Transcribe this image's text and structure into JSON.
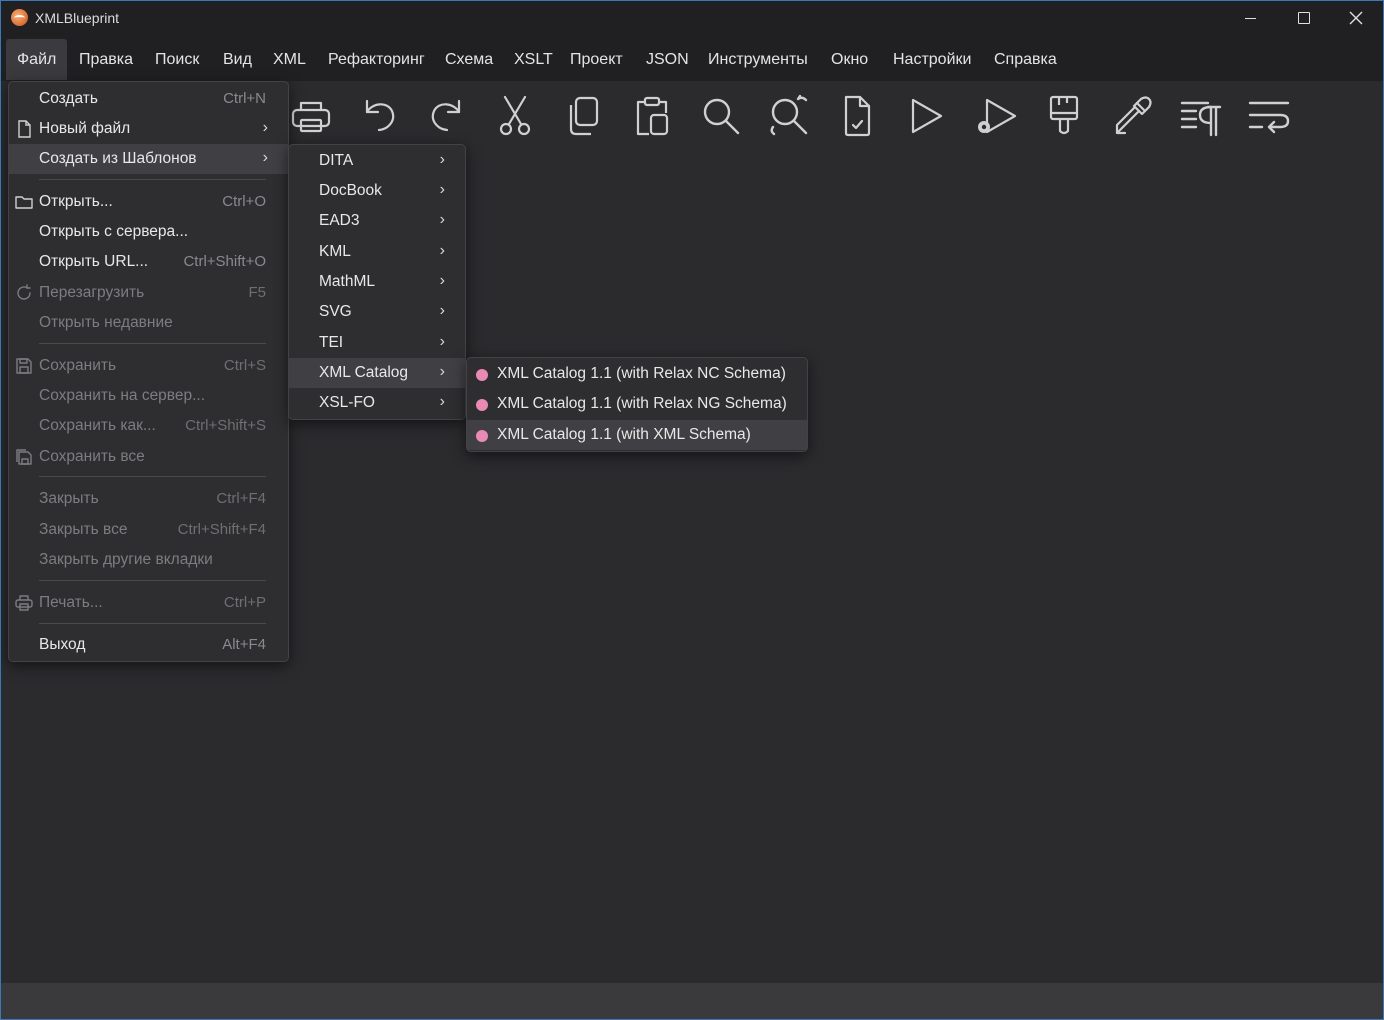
{
  "window": {
    "title": "XMLBlueprint"
  },
  "menubar": [
    {
      "label": "Файл",
      "active": true
    },
    {
      "label": "Правка"
    },
    {
      "label": "Поиск"
    },
    {
      "label": "Вид"
    },
    {
      "label": "XML"
    },
    {
      "label": "Рефакторинг"
    },
    {
      "label": "Схема"
    },
    {
      "label": "XSLT"
    },
    {
      "label": "Проект"
    },
    {
      "label": "JSON"
    },
    {
      "label": "Инструменты"
    },
    {
      "label": "Окно"
    },
    {
      "label": "Настройки"
    },
    {
      "label": "Справка"
    }
  ],
  "toolbar": [
    {
      "icon": "print-icon"
    },
    {
      "icon": "undo-icon"
    },
    {
      "icon": "redo-icon"
    },
    {
      "icon": "cut-icon"
    },
    {
      "icon": "copy-icon"
    },
    {
      "icon": "paste-icon"
    },
    {
      "icon": "search-icon"
    },
    {
      "icon": "search-replace-icon"
    },
    {
      "icon": "validate-document-icon"
    },
    {
      "icon": "run-icon"
    },
    {
      "icon": "run-settings-icon"
    },
    {
      "icon": "format-brush-icon"
    },
    {
      "icon": "eyedropper-icon"
    },
    {
      "icon": "show-formatting-icon"
    },
    {
      "icon": "word-wrap-icon"
    }
  ],
  "file_menu": {
    "items": [
      {
        "label": "Создать",
        "shortcut": "Ctrl+N"
      },
      {
        "label": "Новый файл",
        "submenu": true,
        "icon": "new-file-icon"
      },
      {
        "label": "Создать из Шаблонов",
        "submenu": true,
        "highlight": true
      },
      {
        "label": "Открыть...",
        "shortcut": "Ctrl+O",
        "icon": "folder-icon"
      },
      {
        "label": "Открыть с сервера..."
      },
      {
        "label": "Открыть URL...",
        "shortcut": "Ctrl+Shift+O"
      },
      {
        "label": "Перезагрузить",
        "shortcut": "F5",
        "disabled": true,
        "icon": "reload-icon"
      },
      {
        "label": "Открыть недавние",
        "disabled": true
      },
      {
        "label": "Сохранить",
        "shortcut": "Ctrl+S",
        "disabled": true,
        "icon": "save-icon"
      },
      {
        "label": "Сохранить на сервер...",
        "disabled": true
      },
      {
        "label": "Сохранить как...",
        "shortcut": "Ctrl+Shift+S",
        "disabled": true
      },
      {
        "label": "Сохранить все",
        "disabled": true,
        "icon": "save-all-icon"
      },
      {
        "label": "Закрыть",
        "shortcut": "Ctrl+F4",
        "disabled": true
      },
      {
        "label": "Закрыть все",
        "shortcut": "Ctrl+Shift+F4",
        "disabled": true
      },
      {
        "label": "Закрыть другие вкладки",
        "disabled": true
      },
      {
        "label": "Печать...",
        "shortcut": "Ctrl+P",
        "disabled": true,
        "icon": "print-icon"
      },
      {
        "label": "Выход",
        "shortcut": "Alt+F4"
      }
    ]
  },
  "templates_menu": {
    "items": [
      "DITA",
      "DocBook",
      "EAD3",
      "KML",
      "MathML",
      "SVG",
      "TEI",
      "XML Catalog",
      "XSL-FO"
    ],
    "highlighted": "XML Catalog"
  },
  "catalog_menu": {
    "items": [
      "XML Catalog 1.1 (with Relax NC Schema)",
      "XML Catalog 1.1 (with Relax NG Schema)",
      "XML Catalog 1.1 (with XML Schema)"
    ],
    "highlighted": "XML Catalog 1.1 (with XML Schema)",
    "dot_color": "#e88ab4"
  },
  "colors": {
    "background": "#2b2b2e",
    "chrome": "#202022",
    "menu": "#2e2e31",
    "highlight": "#404044",
    "status_bar": "#3a3a3d"
  }
}
